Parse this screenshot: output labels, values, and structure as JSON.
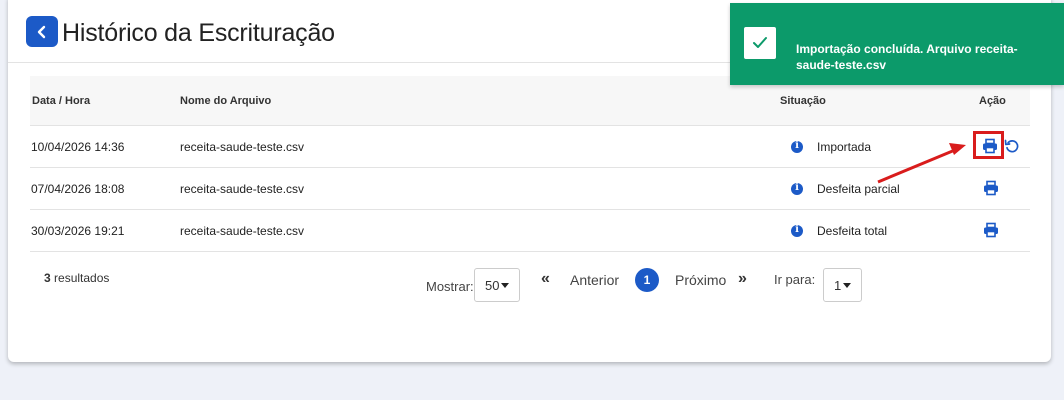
{
  "header": {
    "title": "Histórico da Escrituração"
  },
  "table": {
    "columns": {
      "datetime": "Data / Hora",
      "filename": "Nome do Arquivo",
      "status": "Situação",
      "action": "Ação"
    },
    "rows": [
      {
        "datetime": "10/04/2026 14:36",
        "filename": "receita-saude-teste.csv",
        "status": "Importada"
      },
      {
        "datetime": "07/04/2026 18:08",
        "filename": "receita-saude-teste.csv",
        "status": "Desfeita parcial"
      },
      {
        "datetime": "30/03/2026 19:21",
        "filename": "receita-saude-teste.csv",
        "status": "Desfeita total"
      }
    ]
  },
  "footer": {
    "results_count": "3",
    "results_label": " resultados",
    "show_label": "Mostrar:",
    "page_size": "50",
    "prev_label": "Anterior",
    "current_page": "1",
    "next_label": "Próximo",
    "goto_label": "Ir para:",
    "goto_value": "1"
  },
  "toast": {
    "message": "Importação concluída. Arquivo receita-saude-teste.csv"
  },
  "colors": {
    "primary": "#1c5ac7",
    "toast_bg": "#0c9a6a",
    "highlight": "#d91c1c"
  }
}
